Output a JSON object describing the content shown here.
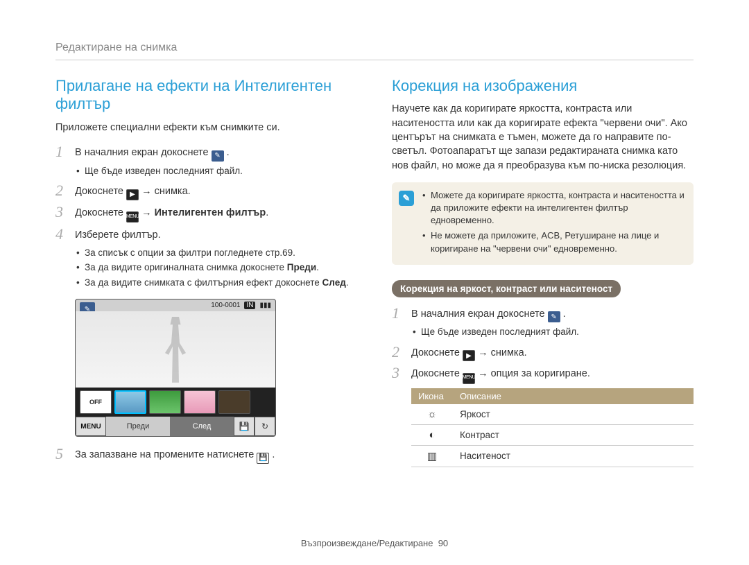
{
  "breadcrumb": "Редактиране на снимка",
  "left": {
    "title": "Прилагане на ефекти на Интелигентен филтър",
    "intro": "Приложете специални ефекти към снимките си.",
    "step1_pre": "В началния екран докоснете ",
    "step1_bullet": "Ще бъде изведен последният файл.",
    "step2_pre": "Докоснете ",
    "step2_mid": " → снимка.",
    "step3_pre": "Докоснете ",
    "step3_arrow": " → ",
    "step3_bold": "Интелигентен филтър",
    "step4": "Изберете филтър.",
    "step4_b1": "За списък с опции за филтри погледнете стр.69.",
    "step4_b2_a": "За да видите оригиналната снимка докоснете ",
    "step4_b2_b": "Преди",
    "step4_b3_a": "За да видите снимката с филтърния ефект докоснете ",
    "step4_b3_b": "След",
    "cam": {
      "counter": "100-0001",
      "in": "IN",
      "off": "OFF",
      "menu": "MENU",
      "before": "Преди",
      "after": "След"
    },
    "step5_pre": "За запазване на промените натиснете "
  },
  "right": {
    "title": "Корекция на изображения",
    "intro": "Научете как да коригирате яркостта, контраста или наситеността или как да коригирате ефекта \"червени очи\". Ако центърът на снимката е тъмен, можете да го направите по-светъл. Фотоапаратът ще запази редактираната снимка като нов файл, но може да я преобразува към по-ниска резолюция.",
    "note1": "Можете да коригирате яркостта, контраста и наситеността и да приложите ефекти на интелигентен филтър едновременно.",
    "note2": "Не можете да приложите, ACB, Ретуширане на лице и коригиране на \"червени очи\" едновременно.",
    "pill": "Корекция на яркост, контраст или наситеност",
    "step1_pre": "В началния екран докоснете ",
    "step1_bullet": "Ще бъде изведен последният файл.",
    "step2_pre": "Докоснете ",
    "step2_mid": " → снимка.",
    "step3_pre": "Докоснете ",
    "step3_mid": " → опция за коригиране.",
    "table": {
      "h1": "Икона",
      "h2": "Описание",
      "r1": "Яркост",
      "r2": "Контраст",
      "r3": "Наситеност"
    }
  },
  "footer": {
    "label": "Възпроизвеждане/Редактиране",
    "page": "90"
  }
}
